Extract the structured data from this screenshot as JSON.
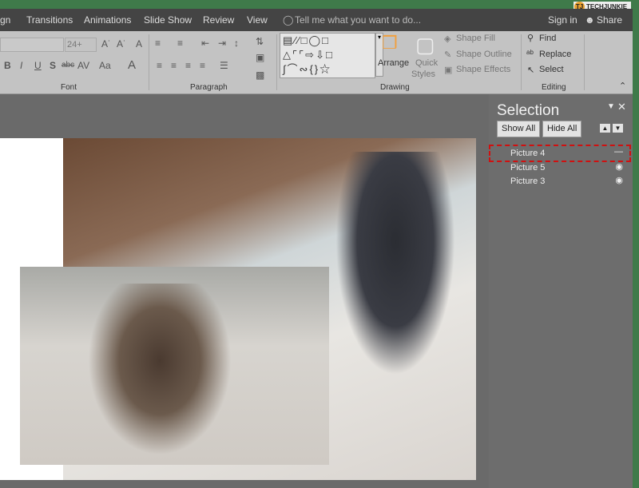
{
  "tabs": [
    "gn",
    "Transitions",
    "Animations",
    "Slide Show",
    "Review",
    "View"
  ],
  "tell_me": "Tell me what you want to do...",
  "sign_in": "Sign in",
  "share": "Share",
  "watermark": "TECHJUNKIE",
  "font": {
    "size": "24+",
    "group": "Font"
  },
  "paragraph": {
    "group": "Paragraph"
  },
  "drawing": {
    "arrange": "Arrange",
    "quick": "Quick",
    "styles": "Styles",
    "shape_fill": "Shape Fill",
    "shape_outline": "Shape Outline",
    "shape_effects": "Shape Effects",
    "group": "Drawing"
  },
  "editing": {
    "find": "Find",
    "replace": "Replace",
    "select": "Select",
    "group": "Editing"
  },
  "selection_pane": {
    "title": "Selection",
    "show_all": "Show All",
    "hide_all": "Hide All",
    "items": [
      {
        "label": "Picture 4",
        "visible": false,
        "selected": true
      },
      {
        "label": "Picture 5",
        "visible": true
      },
      {
        "label": "Picture 3",
        "visible": true
      }
    ]
  },
  "colors": {
    "highlight": "#d01010",
    "title_bar": "#3f7a4a"
  }
}
